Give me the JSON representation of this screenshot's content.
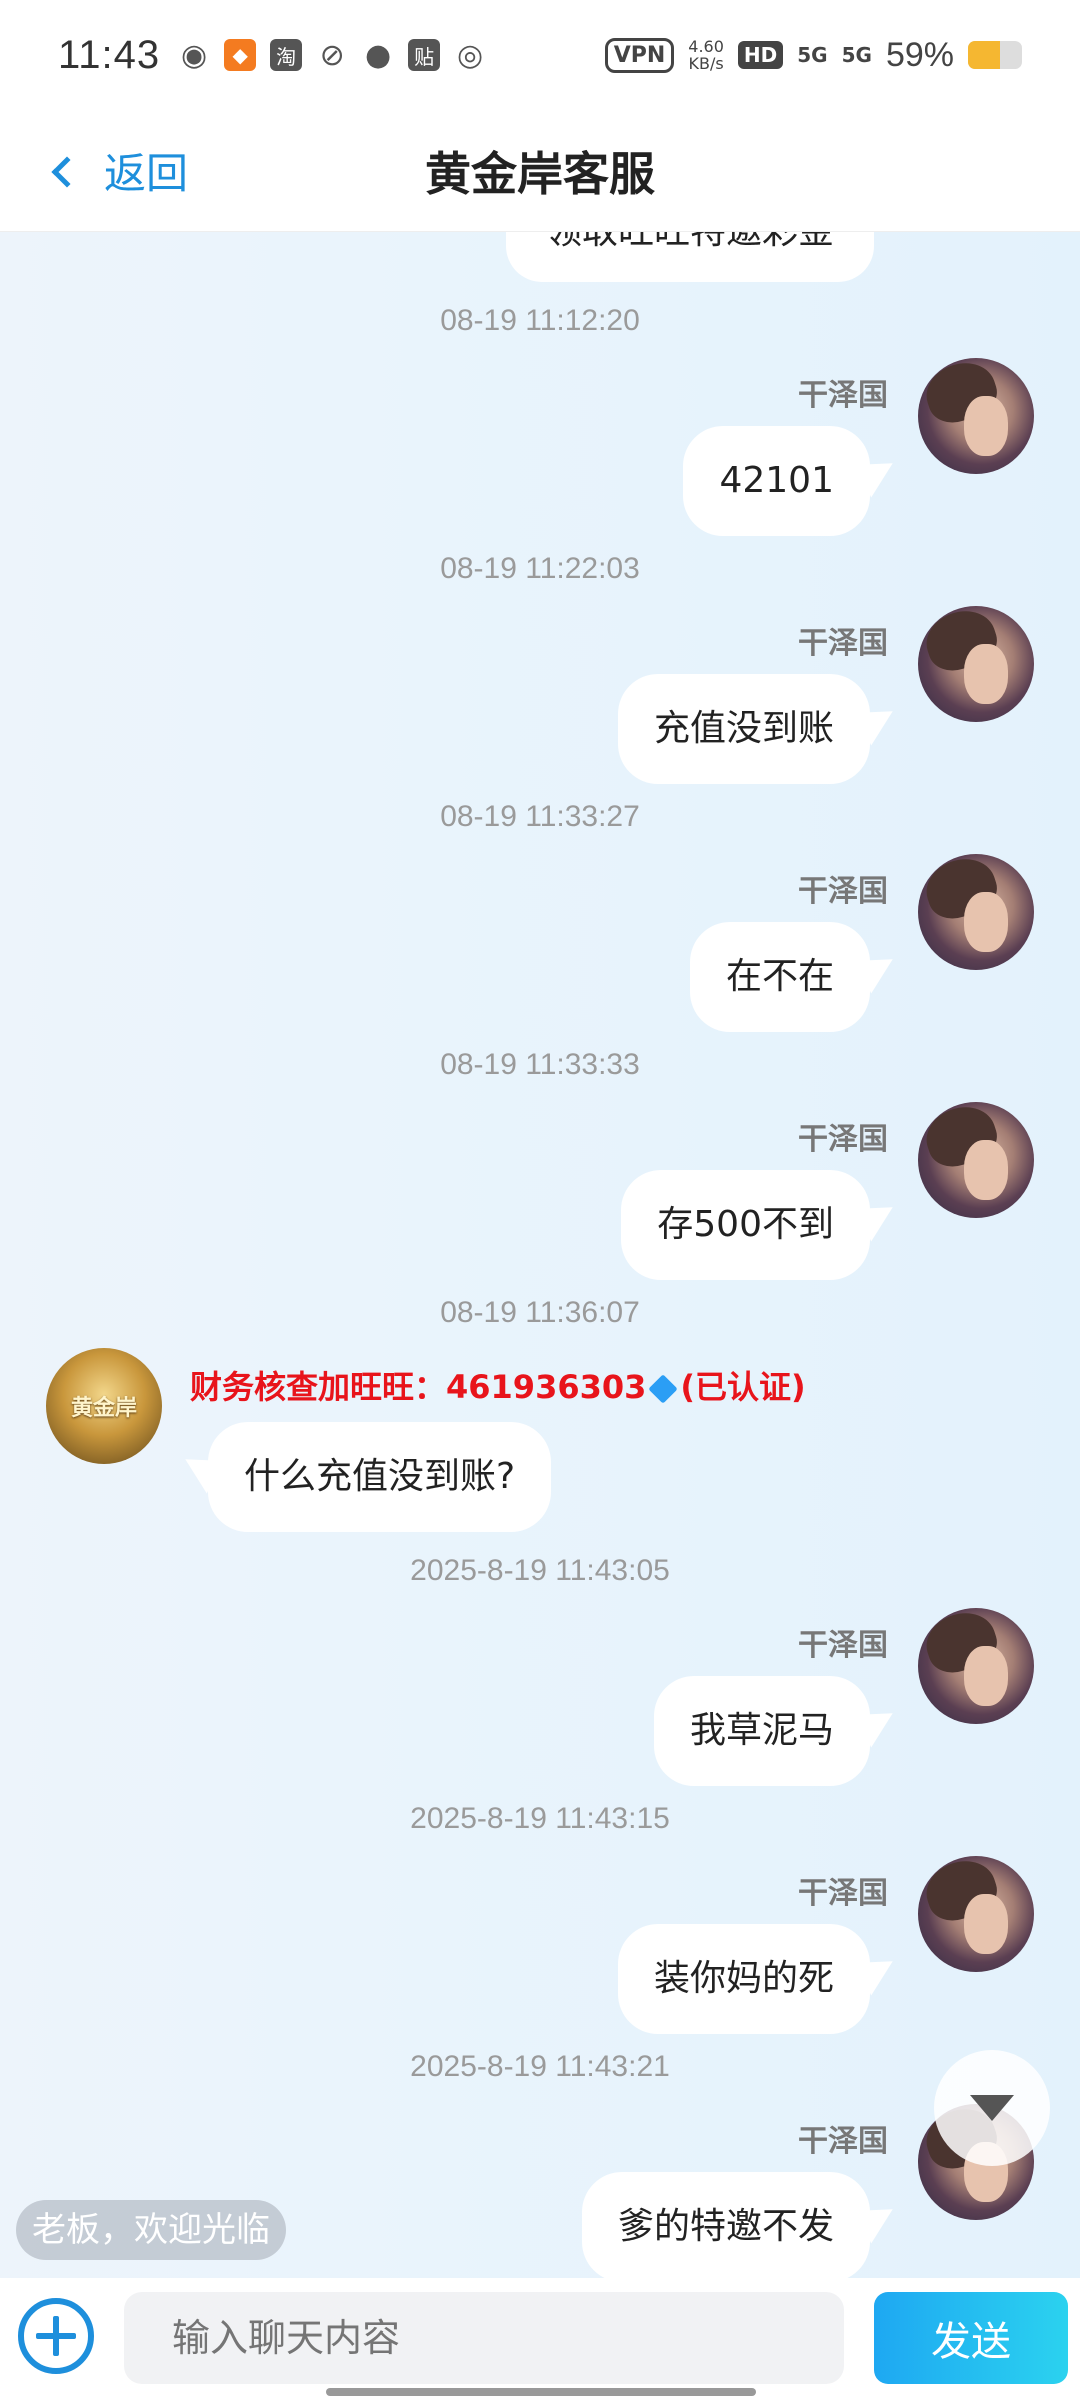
{
  "status_bar": {
    "time": "11:43",
    "vpn": "VPN",
    "speed_value": "4.60",
    "speed_unit": "KB/s",
    "hd": "HD",
    "signal1": "5G",
    "signal2": "5G",
    "battery_percent": "59%",
    "battery_level": 0.59,
    "app_icons": [
      "wechat-icon",
      "fox-app-icon",
      "taobao-icon",
      "leaf-app-icon",
      "message-icon",
      "tieba-icon",
      "weibo-icon"
    ]
  },
  "header": {
    "back_label": "返回",
    "title": "黄金岸客服"
  },
  "chat": {
    "cut_message": "领取旺旺特邀彩金",
    "messages": [
      {
        "timestamp": "08-19 11:12:20",
        "sender": "干泽国",
        "text": "42101"
      },
      {
        "timestamp": "08-19 11:22:03",
        "sender": "干泽国",
        "text": "充值没到账"
      },
      {
        "timestamp": "08-19 11:33:27",
        "sender": "干泽国",
        "text": "在不在"
      },
      {
        "timestamp": "08-19 11:33:33",
        "sender": "干泽国",
        "text": "存500不到"
      },
      {
        "timestamp": "08-19 11:36:07",
        "agent_name": "财务核查加旺旺：461936303",
        "agent_verified": "(已认证)",
        "agent_avatar_text": "黄金岸",
        "text": "什么充值没到账?"
      },
      {
        "timestamp": "2025-8-19 11:43:05",
        "sender": "干泽国",
        "text": "我草泥马"
      },
      {
        "timestamp": "2025-8-19 11:43:15",
        "sender": "干泽国",
        "text": "装你妈的死"
      },
      {
        "timestamp": "2025-8-19 11:43:21",
        "sender": "干泽国",
        "text": "爹的特邀不发"
      }
    ],
    "welcome_tag": "老板，欢迎光临"
  },
  "input_bar": {
    "placeholder": "输入聊天内容",
    "send_label": "发送"
  },
  "colors": {
    "accent": "#1e8fdc",
    "agent_name": "#e8141b",
    "send_button": "#1ea8f2"
  }
}
